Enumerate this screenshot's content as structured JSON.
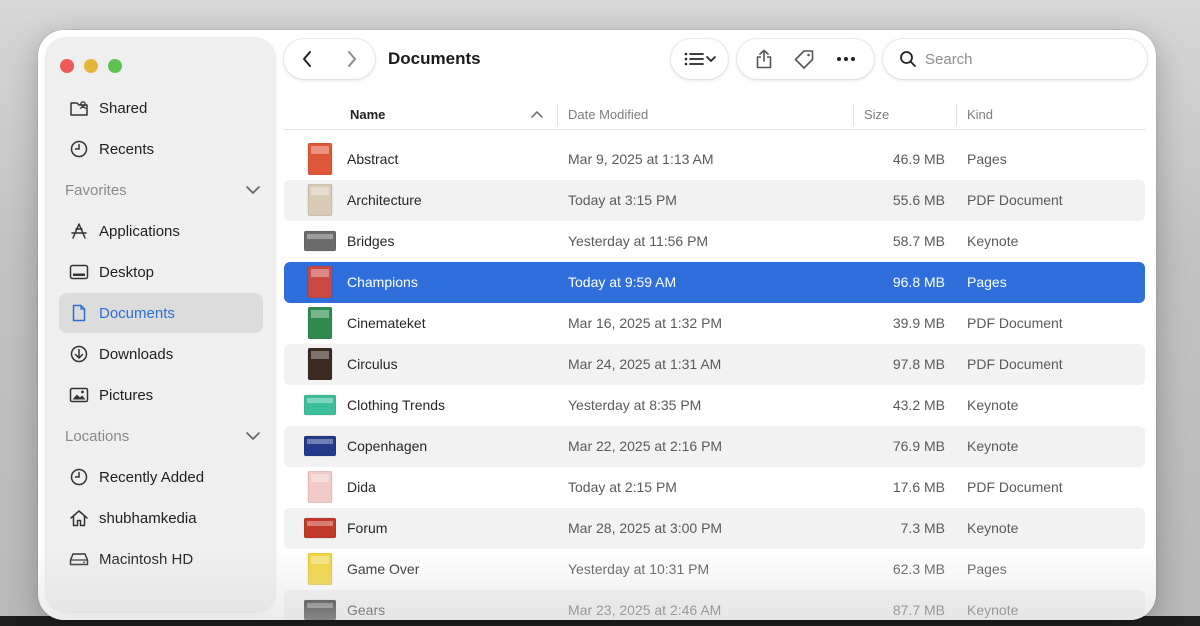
{
  "window": {
    "title": "Documents"
  },
  "sidebar": {
    "top_items": [
      {
        "label": "Shared",
        "icon": "shared-folder-icon"
      },
      {
        "label": "Recents",
        "icon": "clock-icon"
      }
    ],
    "favorites": {
      "heading": "Favorites",
      "items": [
        {
          "label": "Applications",
          "icon": "applications-icon"
        },
        {
          "label": "Desktop",
          "icon": "desktop-icon"
        },
        {
          "label": "Documents",
          "icon": "document-icon",
          "selected": true
        },
        {
          "label": "Downloads",
          "icon": "download-icon"
        },
        {
          "label": "Pictures",
          "icon": "photo-icon"
        }
      ]
    },
    "locations": {
      "heading": "Locations",
      "items": [
        {
          "label": "Recently Added",
          "icon": "clock-icon"
        },
        {
          "label": "shubhamkedia",
          "icon": "home-icon"
        },
        {
          "label": "Macintosh HD",
          "icon": "hard-drive-icon"
        }
      ]
    }
  },
  "toolbar": {
    "search_placeholder": "Search"
  },
  "table": {
    "columns": {
      "name": "Name",
      "date": "Date Modified",
      "size": "Size",
      "kind": "Kind"
    },
    "sort": {
      "column": "Name",
      "direction": "ascending"
    },
    "rows": [
      {
        "name": "Abstract",
        "date": "Mar 9, 2025 at 1:13 AM",
        "size": "46.9 MB",
        "kind": "Pages",
        "thumb": "#e0563a"
      },
      {
        "name": "Architecture",
        "date": "Today at 3:15 PM",
        "size": "55.6 MB",
        "kind": "PDF Document",
        "thumb": "#d9cbb4"
      },
      {
        "name": "Bridges",
        "date": "Yesterday at 11:56 PM",
        "size": "58.7 MB",
        "kind": "Keynote",
        "thumb": "#6b6b6b"
      },
      {
        "name": "Champions",
        "date": "Today at 9:59 AM",
        "size": "96.8 MB",
        "kind": "Pages",
        "thumb": "#c94a44",
        "selected": true
      },
      {
        "name": "Cinemateket",
        "date": "Mar 16, 2025 at 1:32 PM",
        "size": "39.9 MB",
        "kind": "PDF Document",
        "thumb": "#2f8a4e"
      },
      {
        "name": "Circulus",
        "date": "Mar 24, 2025 at 1:31 AM",
        "size": "97.8 MB",
        "kind": "PDF Document",
        "thumb": "#3a2a20"
      },
      {
        "name": "Clothing Trends",
        "date": "Yesterday at 8:35 PM",
        "size": "43.2 MB",
        "kind": "Keynote",
        "thumb": "#3cbf9a"
      },
      {
        "name": "Copenhagen",
        "date": "Mar 22, 2025 at 2:16 PM",
        "size": "76.9 MB",
        "kind": "Keynote",
        "thumb": "#233a8a"
      },
      {
        "name": "Dida",
        "date": "Today at 2:15 PM",
        "size": "17.6 MB",
        "kind": "PDF Document",
        "thumb": "#f1c9c6"
      },
      {
        "name": "Forum",
        "date": "Mar 28, 2025 at 3:00 PM",
        "size": "7.3 MB",
        "kind": "Keynote",
        "thumb": "#c0392b"
      },
      {
        "name": "Game Over",
        "date": "Yesterday at 10:31 PM",
        "size": "62.3 MB",
        "kind": "Pages",
        "thumb": "#f0d53a"
      },
      {
        "name": "Gears",
        "date": "Mar 23, 2025 at 2:46 AM",
        "size": "87.7 MB",
        "kind": "Keynote",
        "thumb": "#1e1e1e"
      }
    ]
  }
}
